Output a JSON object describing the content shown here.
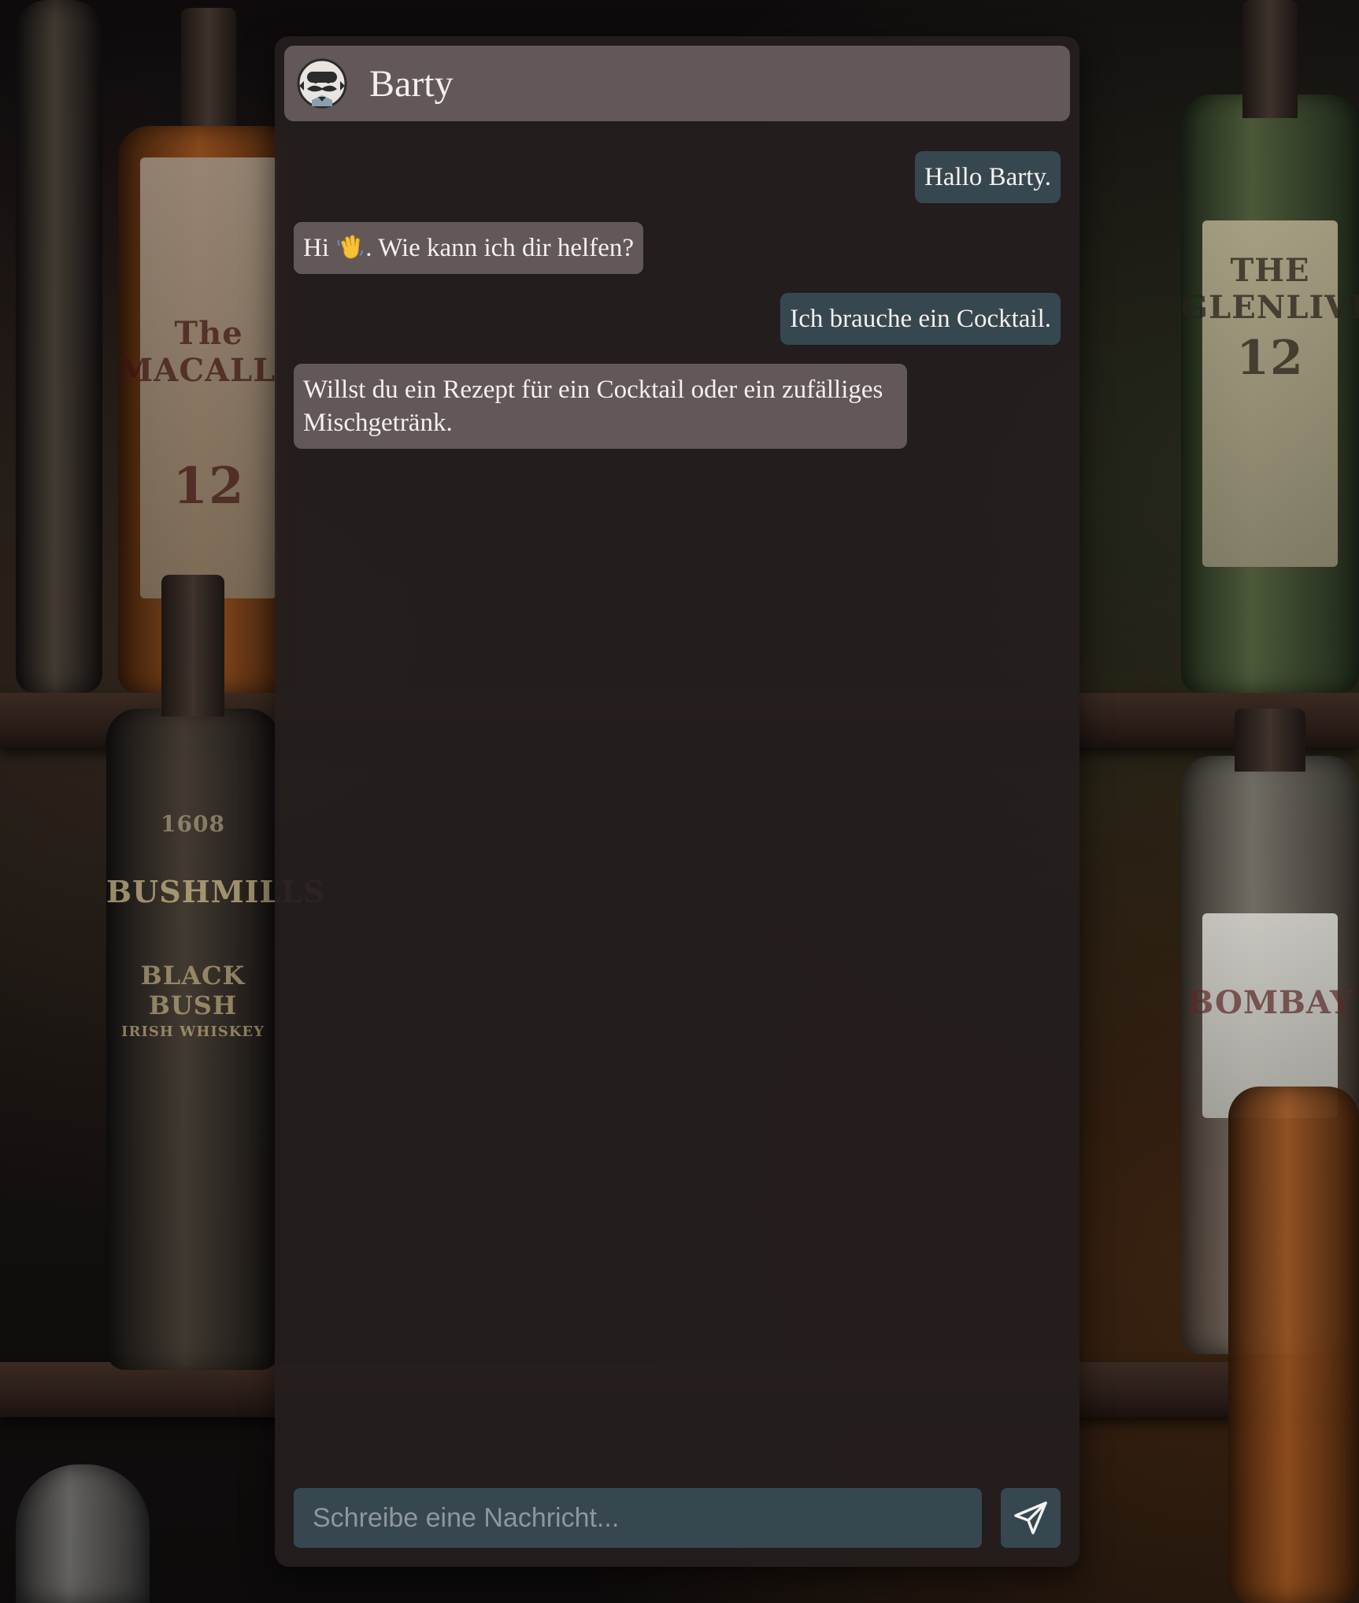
{
  "app": {
    "title": "Barty",
    "avatar_icon": "mustached-bartender-icon"
  },
  "messages": [
    {
      "sender": "user",
      "text": "Hallo Barty."
    },
    {
      "sender": "bot",
      "text_before": "Hi",
      "emoji": "waving-hand-emoji",
      "text_after": ". Wie kann ich dir helfen?"
    },
    {
      "sender": "user",
      "text": "Ich brauche ein Cocktail."
    },
    {
      "sender": "bot",
      "text": "Willst du ein Rezept für ein Cocktail oder ein zufälliges Mischgetränk."
    }
  ],
  "composer": {
    "placeholder": "Schreibe eine Nachricht...",
    "value": "",
    "send_icon": "paper-plane-icon"
  },
  "background": {
    "labels": [
      "The MACALLAN",
      "12",
      "BUSHMILLS",
      "BLACK BUSH",
      "IRISH WHISKEY",
      "1608",
      "THE GLENLIVET",
      "12",
      "BOMBAY"
    ]
  },
  "colors": {
    "user_bubble": "#37474f",
    "bot_bubble": "#625857",
    "header": "#625857",
    "panel": "#241e1e"
  }
}
